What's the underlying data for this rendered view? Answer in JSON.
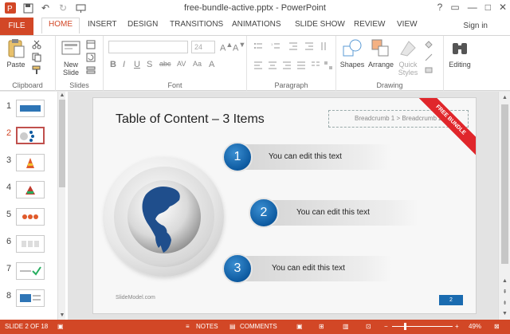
{
  "window": {
    "title": "free-bundle-active.pptx - PowerPoint",
    "controls": [
      "?",
      "▭",
      "—",
      "□",
      "✕"
    ]
  },
  "qat": {
    "icons": [
      "powerpoint-logo-icon",
      "save-icon",
      "undo-icon",
      "redo-icon",
      "start-slideshow-icon"
    ]
  },
  "tabs": {
    "file": "FILE",
    "items": [
      "HOME",
      "INSERT",
      "DESIGN",
      "TRANSITIONS",
      "ANIMATIONS",
      "SLIDE SHOW",
      "REVIEW",
      "VIEW"
    ],
    "active": "HOME",
    "signin": "Sign in"
  },
  "ribbon": {
    "clipboard": {
      "label": "Clipboard",
      "paste": "Paste"
    },
    "slides": {
      "label": "Slides",
      "new_slide": "New",
      "new_slide2": "Slide"
    },
    "font": {
      "label": "Font",
      "size": "24"
    },
    "paragraph": {
      "label": "Paragraph"
    },
    "drawing": {
      "label": "Drawing",
      "shapes": "Shapes",
      "arrange": "Arrange",
      "quick_styles": "Quick",
      "quick_styles2": "Styles"
    },
    "editing": {
      "label": "Editing"
    }
  },
  "slides_panel": {
    "slides": [
      "1",
      "2",
      "3",
      "4",
      "5",
      "6",
      "7",
      "8"
    ],
    "selected": "2"
  },
  "slide": {
    "title": "Table of Content – 3 Items",
    "breadcrumb": "Breadcrumb 1 > Breadcrumb 2",
    "ribbon_text": "FREE BUNDLE",
    "items": [
      {
        "num": "1",
        "text": "You can edit this text"
      },
      {
        "num": "2",
        "text": "You can edit this text"
      },
      {
        "num": "3",
        "text": "You can edit this text"
      }
    ],
    "footer": "SlideModel.com",
    "page_number": "2"
  },
  "status": {
    "slide_info": "SLIDE 2 OF 18",
    "notes": "NOTES",
    "comments": "COMMENTS",
    "zoom": "49%"
  },
  "colors": {
    "accent": "#d24726",
    "circle": "#0d5aa0",
    "ribbon": "#e0262b"
  }
}
